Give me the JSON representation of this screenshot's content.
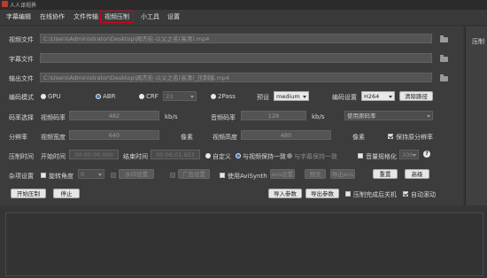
{
  "window": {
    "title": "人人译视界"
  },
  "menu": [
    "字幕编辑",
    "在线协作",
    "文件传输",
    "视频压制",
    "小工具",
    "设置"
  ],
  "files": {
    "video_label": "视频文件",
    "video_path": "C:\\Users\\Administrator\\Desktop\\闻杰伦-以父之名(高清).mp4",
    "subtitle_label": "字幕文件",
    "subtitle_path": "",
    "output_label": "输出文件",
    "output_path": "C:\\Users\\Administrator\\Desktop\\闻杰伦-以父之名(高清)_压制版.mp4"
  },
  "right_panel_label": "压制",
  "encode": {
    "mode_label": "编码模式",
    "gpu": "GPU",
    "abr": "ABR",
    "crf": "CRF",
    "crf_value": "23",
    "twopass": "2Pass",
    "preset_label": "预设",
    "preset_value": "medium",
    "codec_label": "编码设置",
    "codec_value": "H264",
    "clear_path": "清除路径"
  },
  "bitrate": {
    "label": "码率选择",
    "video_label": "视频码率",
    "video_value": "482",
    "video_unit": "kb/s",
    "audio_label": "音频码率",
    "audio_value": "128",
    "audio_unit": "kb/s",
    "source_option": "使用原码率"
  },
  "resolution": {
    "label": "分辨率",
    "width_label": "视频宽度",
    "width_value": "640",
    "width_unit": "像素",
    "height_label": "视频高度",
    "height_value": "480",
    "height_unit": "像素",
    "keep_ratio": "保持原分辨率"
  },
  "time": {
    "label": "压制时间",
    "start_label": "开始时间",
    "start_value": "00:00:00.000",
    "end_label": "结束时间",
    "end_value": "00:06:01.953",
    "custom": "自定义",
    "same_as_video": "与视频保持一致",
    "same_as_subtitle": "与字幕保持一致",
    "normalize": "音量规格化",
    "normalize_value": "100"
  },
  "misc": {
    "label": "杂项设置",
    "rotate_label": "旋转角度",
    "rotate_value": "0",
    "watermark": "水印设置",
    "ad": "广告设置",
    "avisynth": "使用AviSynth",
    "avs_settings": "avs设置",
    "preview": "预览",
    "export_avs": "导出avs",
    "reset": "重置",
    "advanced": "高级"
  },
  "actions": {
    "start": "开始压制",
    "stop": "停止",
    "import_params": "导入参数",
    "export_params": "导出参数",
    "shutdown": "压制完成后关机",
    "auto_scroll": "自动滚动"
  }
}
